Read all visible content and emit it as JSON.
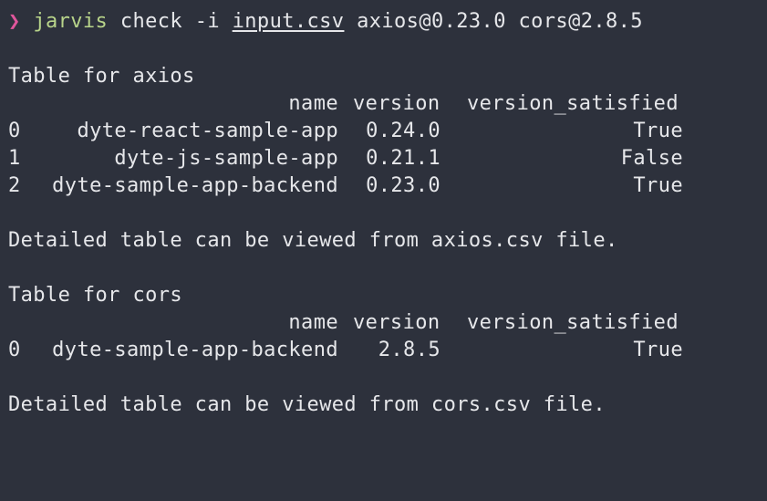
{
  "prompt": {
    "arrow": "❯",
    "program": "jarvis",
    "args_before": " check -i ",
    "input_file": "input.csv",
    "args_after": " axios@0.23.0 cors@2.8.5"
  },
  "tables": [
    {
      "heading": "Table for axios",
      "columns": [
        "name",
        "version",
        "version_satisfied"
      ],
      "rows": [
        {
          "index": "0",
          "name": "dyte-react-sample-app",
          "version": "0.24.0",
          "satisfied": "True"
        },
        {
          "index": "1",
          "name": "dyte-js-sample-app",
          "version": "0.21.1",
          "satisfied": "False"
        },
        {
          "index": "2",
          "name": "dyte-sample-app-backend",
          "version": "0.23.0",
          "satisfied": "True"
        }
      ],
      "footer": "Detailed table can be viewed from axios.csv file."
    },
    {
      "heading": "Table for cors",
      "columns": [
        "name",
        "version",
        "version_satisfied"
      ],
      "rows": [
        {
          "index": "0",
          "name": "dyte-sample-app-backend",
          "version": "2.8.5",
          "satisfied": "True"
        }
      ],
      "footer": "Detailed table can be viewed from cors.csv file."
    }
  ],
  "colors": {
    "background": "#2d313c",
    "foreground": "#e6e7ea",
    "prompt_arrow": "#e0569c",
    "program": "#b8d48a"
  }
}
